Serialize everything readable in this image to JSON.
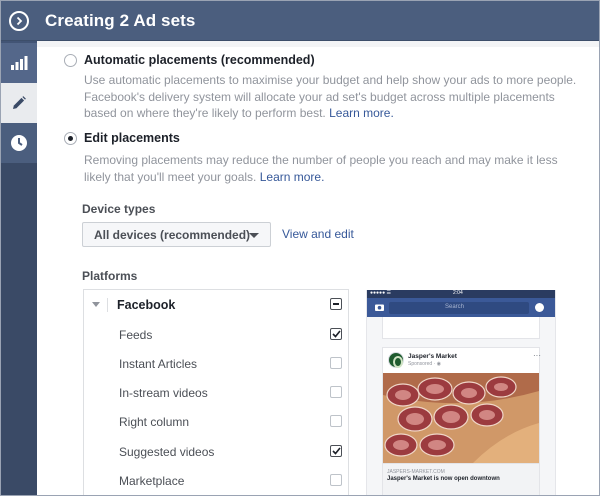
{
  "header": {
    "title": "Creating 2 Ad sets"
  },
  "rail": {
    "items": [
      {
        "icon": "bar-chart-icon"
      },
      {
        "icon": "pencil-icon"
      },
      {
        "icon": "clock-icon"
      }
    ]
  },
  "placements": {
    "automatic": {
      "title": "Automatic placements (recommended)",
      "description": "Use automatic placements to maximise your budget and help show your ads to more people. Facebook's delivery system will allocate your ad set's budget across multiple placements based on where they're likely to perform best.",
      "link": "Learn more.",
      "selected": false
    },
    "edit": {
      "title": "Edit placements",
      "description": "Removing placements may reduce the number of people you reach and may make it less likely that you'll meet your goals.",
      "link": "Learn more.",
      "selected": true
    }
  },
  "device_types": {
    "label": "Device types",
    "selected": "All devices (recommended)",
    "view_edit": "View and edit"
  },
  "platforms": {
    "label": "Platforms",
    "group": "Facebook",
    "items": [
      {
        "label": "Feeds",
        "checked": true
      },
      {
        "label": "Instant Articles",
        "checked": false
      },
      {
        "label": "In-stream videos",
        "checked": false
      },
      {
        "label": "Right column",
        "checked": false
      },
      {
        "label": "Suggested videos",
        "checked": true
      },
      {
        "label": "Marketplace",
        "checked": false
      }
    ]
  },
  "preview": {
    "status_left": "●●●●● ☰",
    "status_time": "2:04",
    "search_placeholder": "Search",
    "brand": "Jasper's Market",
    "sponsored": "Sponsored · ◉",
    "domain": "JASPERS-MARKET.COM",
    "headline": "Jasper's Market is now open downtown"
  },
  "colors": {
    "header_bg": "#4b5e7e",
    "link": "#365899",
    "phone_nav": "#3b5998"
  }
}
